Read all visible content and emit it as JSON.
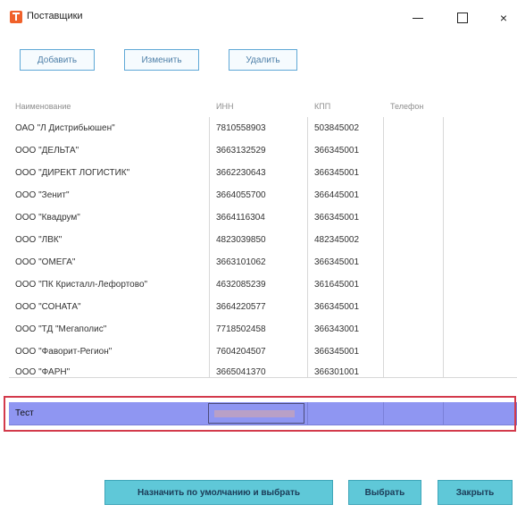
{
  "window": {
    "title": "Поставщики",
    "close_glyph": "×"
  },
  "toolbar": {
    "add": "Добавить",
    "edit": "Изменить",
    "delete": "Удалить"
  },
  "columns": [
    "Наименование",
    "ИНН",
    "КПП",
    "Телефон"
  ],
  "rows": [
    {
      "name": "ОАО \"Л Дистрибьюшен\"",
      "inn": "7810558903",
      "kpp": "503845002",
      "phone": ""
    },
    {
      "name": "ООО \"ДЕЛЬТА\"",
      "inn": "3663132529",
      "kpp": "366345001",
      "phone": ""
    },
    {
      "name": "ООО \"ДИРЕКТ ЛОГИСТИК\"",
      "inn": "3662230643",
      "kpp": "366345001",
      "phone": ""
    },
    {
      "name": "ООО \"Зенит\"",
      "inn": "3664055700",
      "kpp": "366445001",
      "phone": ""
    },
    {
      "name": "ООО \"Квадрум\"",
      "inn": "3664116304",
      "kpp": "366345001",
      "phone": ""
    },
    {
      "name": "ООО \"ЛВК\"",
      "inn": "4823039850",
      "kpp": "482345002",
      "phone": ""
    },
    {
      "name": "ООО \"ОМЕГА\"",
      "inn": "3663101062",
      "kpp": "366345001",
      "phone": ""
    },
    {
      "name": "ООО \"ПК Кристалл-Лефортово\"",
      "inn": "4632085239",
      "kpp": "361645001",
      "phone": ""
    },
    {
      "name": "ООО \"СОНАТА\"",
      "inn": "3664220577",
      "kpp": "366345001",
      "phone": ""
    },
    {
      "name": "ООО \"ТД \"Мегаполис\"",
      "inn": "7718502458",
      "kpp": "366343001",
      "phone": ""
    },
    {
      "name": "ООО \"Фаворит-Регион\"",
      "inn": "7604204507",
      "kpp": "366345001",
      "phone": ""
    },
    {
      "name": "ООО \"ФАРН\"",
      "inn": "3665041370",
      "kpp": "366301001",
      "phone": ""
    }
  ],
  "new_row": {
    "name": "Тест"
  },
  "footer": {
    "set_default": "Назначить по умолчанию и выбрать",
    "select": "Выбрать",
    "close": "Закрыть"
  },
  "colors": {
    "selection": "#8f96f2",
    "outline": "#d33a4b",
    "button": "#5fc8d8"
  }
}
